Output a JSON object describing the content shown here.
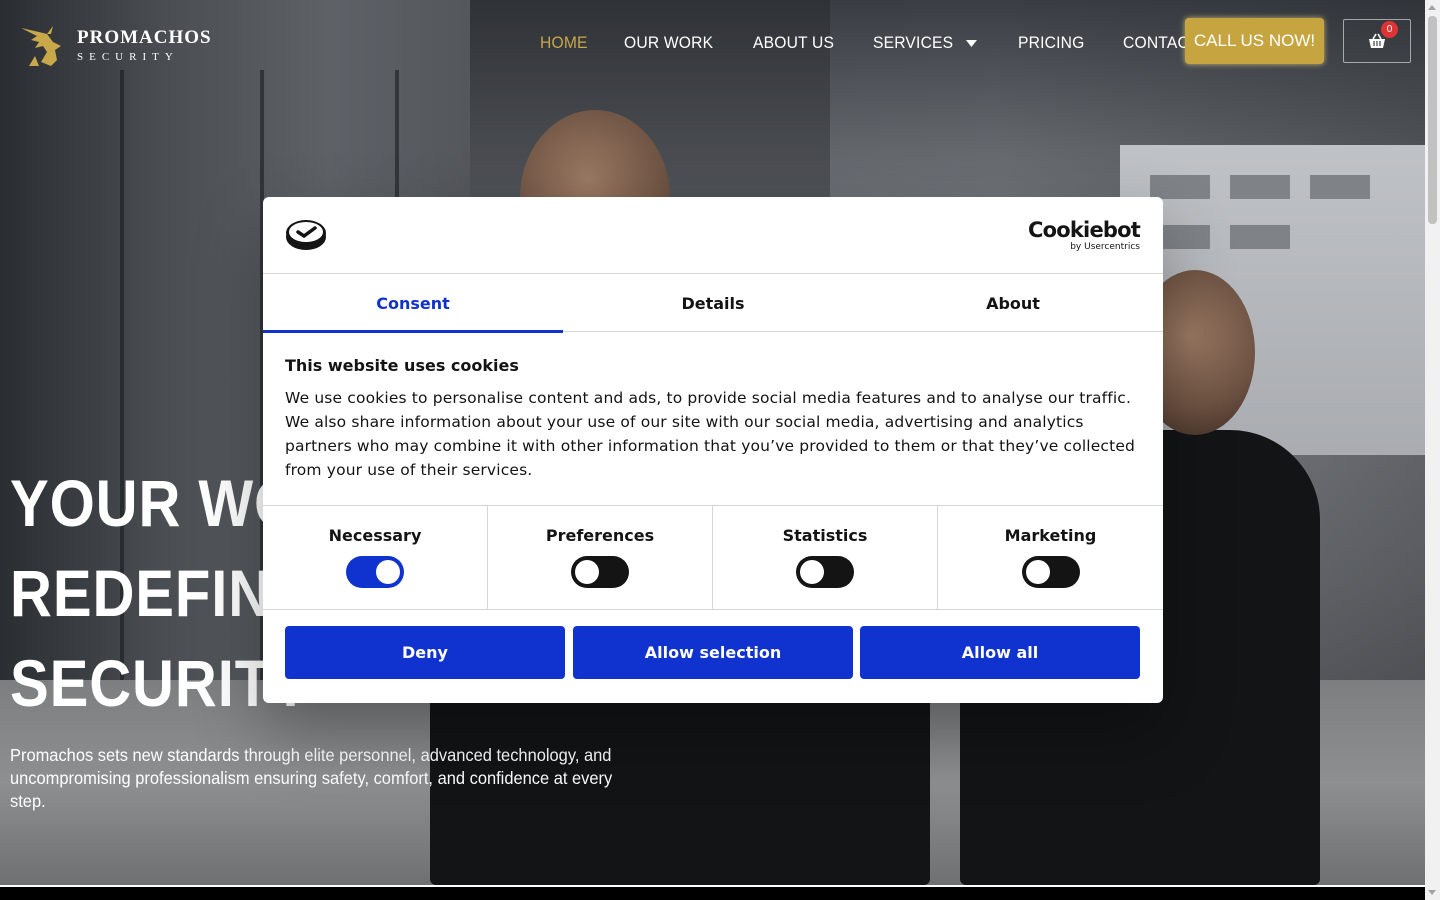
{
  "brand": {
    "name": "PROMACHOS",
    "tagline": "SECURITY",
    "gold": "#c9a84a"
  },
  "nav": {
    "items": [
      {
        "label": "HOME",
        "active": true
      },
      {
        "label": "OUR WORK",
        "active": false
      },
      {
        "label": "ABOUT US",
        "active": false
      },
      {
        "label": "SERVICES",
        "active": false,
        "dropdown": true
      },
      {
        "label": "PRICING",
        "active": false
      },
      {
        "label": "CONTACT US",
        "active": false
      }
    ],
    "cta_label": "CALL US NOW!",
    "cart_count": "0",
    "cart_icon": "basket-icon"
  },
  "hero": {
    "title_lines": [
      "YOUR WO",
      "REDEFINI",
      "SECURITY"
    ],
    "description_line1": "Promachos sets new standards through elite personnel, advanced technology, and",
    "description_line2": "uncompromising professionalism ensuring safety, comfort, and confidence at every step."
  },
  "cookie": {
    "provider": "Cookiebot",
    "provider_by": "by Usercentrics",
    "tabs": [
      {
        "label": "Consent",
        "active": true
      },
      {
        "label": "Details",
        "active": false
      },
      {
        "label": "About",
        "active": false
      }
    ],
    "heading": "This website uses cookies",
    "body": "We use cookies to personalise content and ads, to provide social media features and to analyse our traffic. We also share information about your use of our site with our social media, advertising and analytics partners who may combine it with other information that you’ve provided to them or that they’ve collected from your use of their services.",
    "categories": [
      {
        "label": "Necessary",
        "checked": true
      },
      {
        "label": "Preferences",
        "checked": false
      },
      {
        "label": "Statistics",
        "checked": false
      },
      {
        "label": "Marketing",
        "checked": false
      }
    ],
    "buttons": {
      "deny": "Deny",
      "allow_selection": "Allow selection",
      "allow_all": "Allow all"
    },
    "accent": "#1032cf"
  }
}
